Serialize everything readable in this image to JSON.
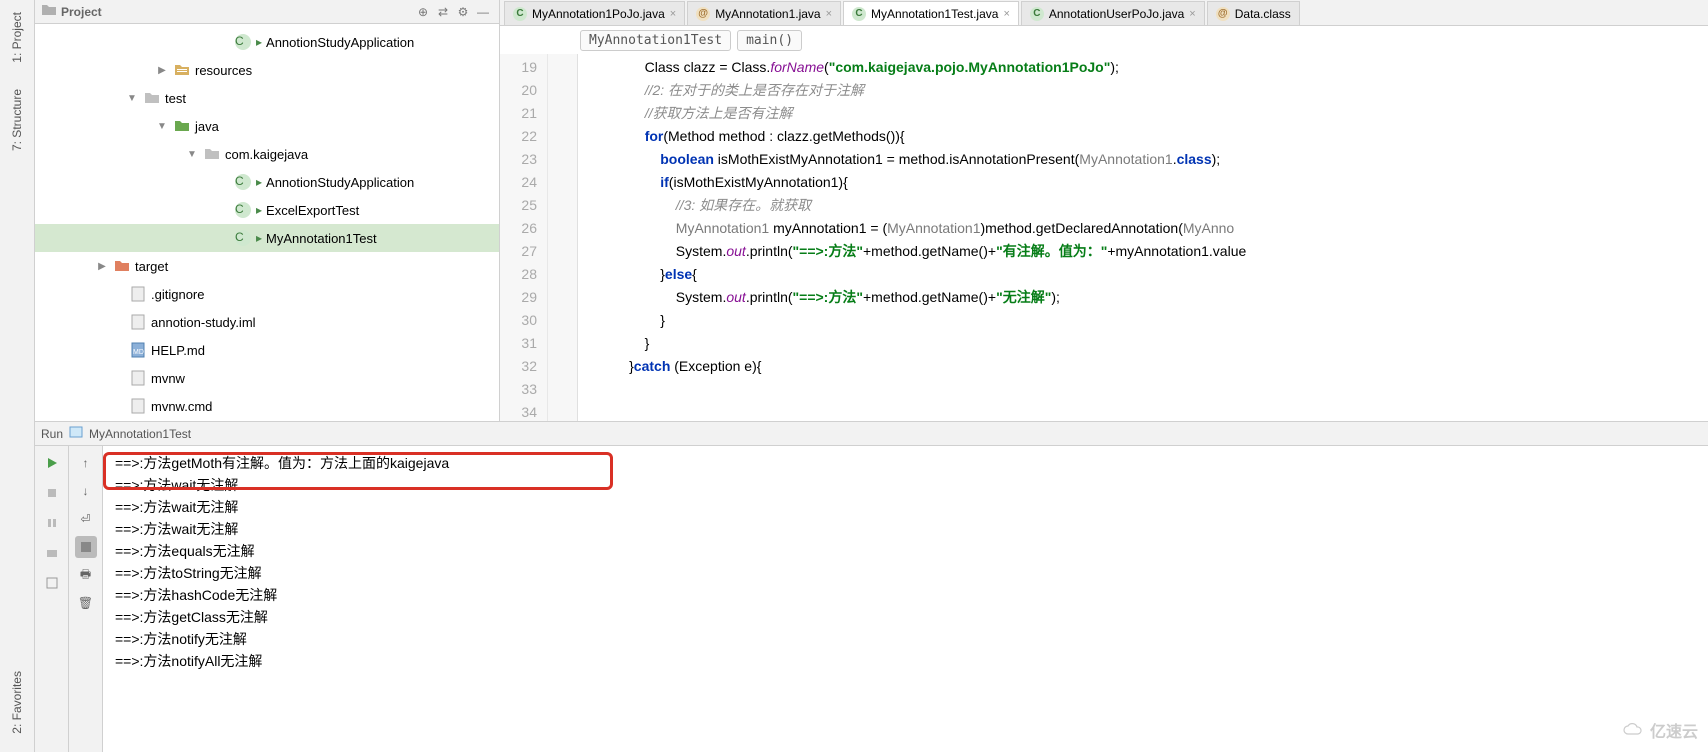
{
  "sidebar_tabs": {
    "project": "1: Project",
    "structure": "7: Structure",
    "favorites": "2: Favorites"
  },
  "project_panel": {
    "title": "Project"
  },
  "tree": {
    "app1": "AnnotionStudyApplication",
    "resources": "resources",
    "test": "test",
    "java": "java",
    "pkg": "com.kaigejava",
    "class1": "AnnotionStudyApplication",
    "class2": "ExcelExportTest",
    "class3": "MyAnnotation1Test",
    "target": "target",
    "gitignore": ".gitignore",
    "iml": "annotion-study.iml",
    "help": "HELP.md",
    "mvnw": "mvnw",
    "mvnwcmd": "mvnw.cmd"
  },
  "editor_tabs": {
    "t1": "MyAnnotation1PoJo.java",
    "t2": "MyAnnotation1.java",
    "t3": "MyAnnotation1Test.java",
    "t4": "AnnotationUserPoJo.java",
    "t5": "Data.class"
  },
  "breadcrumb": {
    "b1": "MyAnnotation1Test",
    "b2": "main()"
  },
  "code": {
    "line_start": 19,
    "lines": [
      "            Class clazz = Class.<fld>forName</fld>(<str>\"com.kaigejava.pojo.MyAnnotation1PoJo\"</str>);",
      "            <cmt>//2: 在对于的类上是否存在对于注解</cmt>",
      "            <cmt>//获取方法上是否有注解</cmt>",
      "            <kw>for</kw>(Method method : clazz.getMethods()){",
      "                <kw>boolean</kw> isMothExistMyAnnotation1 = method.isAnnotationPresent(<ann-cls>MyAnnotation1</ann-cls>.<kw>class</kw>);",
      "                <kw>if</kw>(isMothExistMyAnnotation1){",
      "                    <cmt>//3: 如果存在。就获取</cmt>",
      "                    <ann-cls>MyAnnotation1</ann-cls> myAnnotation1 = (<ann-cls>MyAnnotation1</ann-cls>)method.getDeclaredAnnotation(<ann-cls>MyAnno</ann-cls>",
      "                    System.<fld>out</fld>.println(<str>\"==>:方法\"</str>+method.getName()+<str>\"有注解。值为：\"</str>+myAnnotation1.value",
      "",
      "                }<kw>else</kw>{",
      "                    System.<fld>out</fld>.println(<str>\"==>:方法\"</str>+method.getName()+<str>\"无注解\"</str>);",
      "                }",
      "            }",
      "",
      "        }<kw>catch</kw> (Exception e){"
    ]
  },
  "run": {
    "label": "Run",
    "config": "MyAnnotation1Test"
  },
  "console": {
    "l1": "==>:方法getMoth有注解。值为：方法上面的kaigejava",
    "l2": "==>:方法wait无注解",
    "l3": "==>:方法wait无注解",
    "l4": "==>:方法wait无注解",
    "l5": "==>:方法equals无注解",
    "l6": "==>:方法toString无注解",
    "l7": "==>:方法hashCode无注解",
    "l8": "==>:方法getClass无注解",
    "l9": "==>:方法notify无注解",
    "l10": "==>:方法notifyAll无注解"
  },
  "watermark": "亿速云"
}
